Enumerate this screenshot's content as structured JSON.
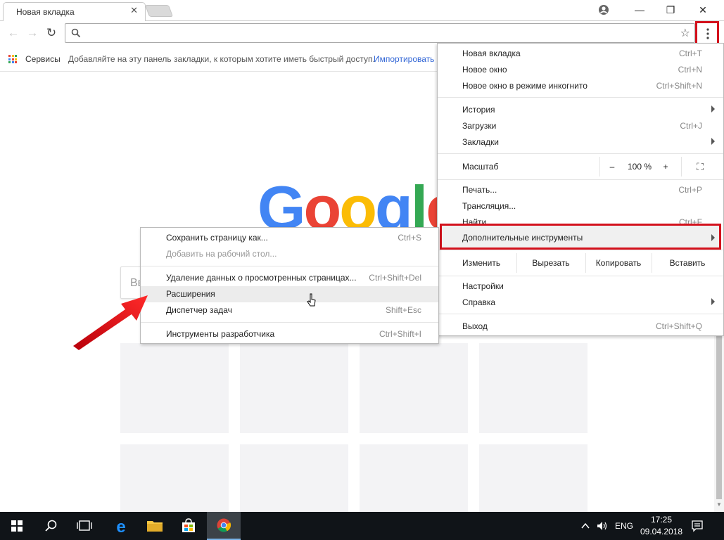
{
  "window": {
    "tab_title": "Новая вкладка",
    "tab_close": "✕",
    "min_glyph": "—",
    "restore_glyph": "❐",
    "close_glyph": "✕"
  },
  "toolbar": {
    "back_glyph": "←",
    "forward_glyph": "→",
    "reload_glyph": "↻",
    "omnibox_value": "",
    "star_glyph": "☆"
  },
  "bookmarks": {
    "apps_label": "Сервисы",
    "hint": "Добавляйте на эту панель закладки, к которым хотите иметь быстрый доступ.",
    "import_link": "Импортировать"
  },
  "page": {
    "logo_letters": [
      "G",
      "o",
      "o",
      "g",
      "l",
      "e"
    ],
    "logo_colors": [
      "#4285F4",
      "#EA4335",
      "#FBBC05",
      "#4285F4",
      "#34A853",
      "#EA4335"
    ],
    "search_placeholder": "Вв"
  },
  "main_menu": {
    "new_tab": {
      "label": "Новая вкладка",
      "shortcut": "Ctrl+T"
    },
    "new_window": {
      "label": "Новое окно",
      "shortcut": "Ctrl+N"
    },
    "incognito": {
      "label": "Новое окно в режиме инкогнито",
      "shortcut": "Ctrl+Shift+N"
    },
    "history": {
      "label": "История"
    },
    "downloads": {
      "label": "Загрузки",
      "shortcut": "Ctrl+J"
    },
    "bookmarks": {
      "label": "Закладки"
    },
    "zoom": {
      "label": "Масштаб",
      "minus": "–",
      "value": "100 %",
      "plus": "+",
      "fullscreen": "⛶"
    },
    "print": {
      "label": "Печать...",
      "shortcut": "Ctrl+P"
    },
    "cast": {
      "label": "Трансляция..."
    },
    "find": {
      "label": "Найти...",
      "shortcut": "Ctrl+F"
    },
    "more_tools": {
      "label": "Дополнительные инструменты"
    },
    "edit": {
      "label": "Изменить",
      "cut": "Вырезать",
      "copy": "Копировать",
      "paste": "Вставить"
    },
    "settings": {
      "label": "Настройки"
    },
    "help": {
      "label": "Справка"
    },
    "exit": {
      "label": "Выход",
      "shortcut": "Ctrl+Shift+Q"
    }
  },
  "sub_menu": {
    "save_page": {
      "label": "Сохранить страницу как...",
      "shortcut": "Ctrl+S"
    },
    "add_desktop": {
      "label": "Добавить на рабочий стол..."
    },
    "clear_data": {
      "label": "Удаление данных о просмотренных страницах...",
      "shortcut": "Ctrl+Shift+Del"
    },
    "extensions": {
      "label": "Расширения"
    },
    "task_manager": {
      "label": "Диспетчер задач",
      "shortcut": "Shift+Esc"
    },
    "dev_tools": {
      "label": "Инструменты разработчика",
      "shortcut": "Ctrl+Shift+I"
    }
  },
  "taskbar": {
    "lang": "ENG",
    "time": "17:25",
    "date": "09.04.2018"
  },
  "colors": {
    "highlight_red": "#d3111c",
    "taskbar_bg": "#101418"
  }
}
